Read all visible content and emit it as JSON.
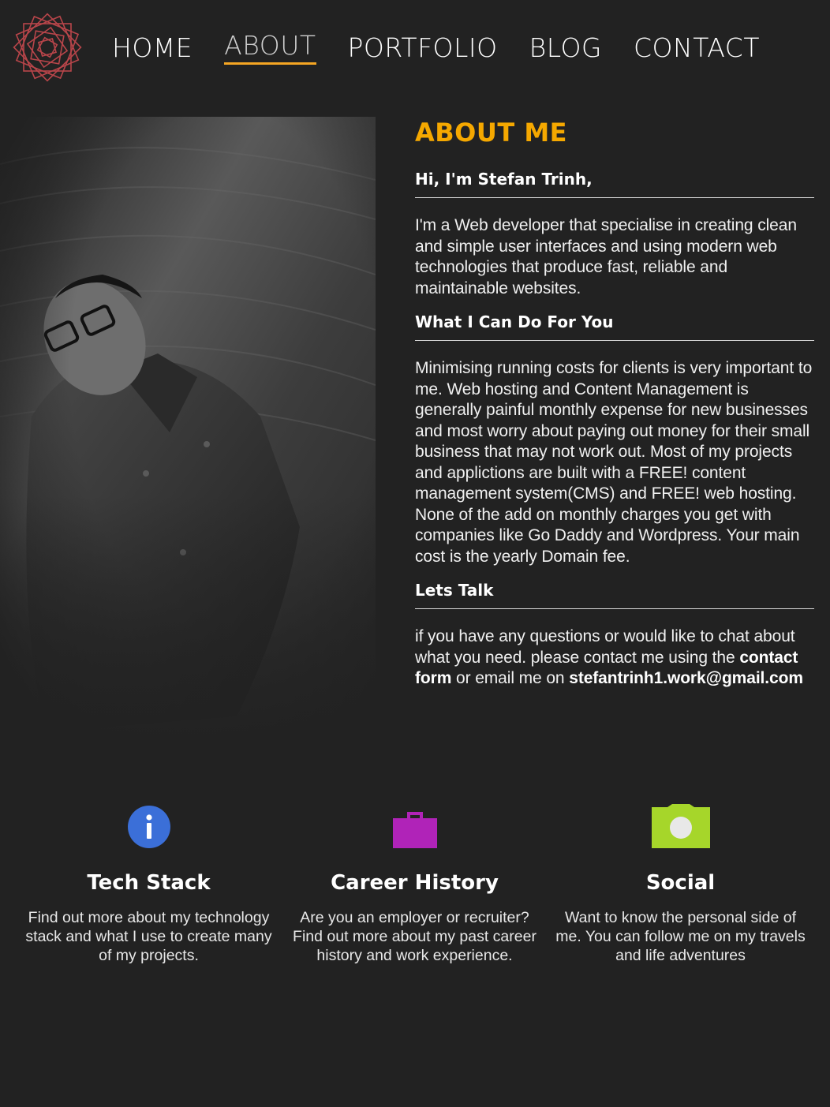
{
  "nav": {
    "logo": "logo-mark",
    "items": [
      {
        "label": "HOME",
        "active": false
      },
      {
        "label": "ABOUT",
        "active": true
      },
      {
        "label": "PORTFOLIO",
        "active": false
      },
      {
        "label": "BLOG",
        "active": false
      },
      {
        "label": "CONTACT",
        "active": false
      }
    ],
    "active_color": "#f5a623"
  },
  "about": {
    "title": "ABOUT ME",
    "greeting": "Hi, I'm Stefan Trinh,",
    "intro": "I'm a Web developer that specialise in creating clean and simple user interfaces and using modern web technologies that produce fast, reliable and maintainable websites.",
    "what_title": "What I Can Do For You",
    "what_text": "Minimising running costs for clients is very important to me. Web hosting and Content Management is generally painful monthly expense for new businesses and most worry about paying out money for their small business that may not work out. Most of my projects and applictions are built with a FREE! content management system(CMS) and FREE! web hosting. None of the add on monthly charges you get with companies like Go Daddy and Wordpress. Your main cost is the yearly Domain fee.",
    "talk_title": "Lets Talk",
    "talk_text_1": "if you have any questions or would like to chat about what you need. please contact me using the ",
    "talk_link": "contact form",
    "talk_text_2": " or email me on ",
    "talk_email": "stefantrinh1.work@gmail.com",
    "title_color": "#f5a800"
  },
  "features": [
    {
      "icon": "info-icon",
      "color": "#3b6fd8",
      "title": "Tech Stack",
      "text": "Find out more about my technology stack and what I use to create many of my projects."
    },
    {
      "icon": "briefcase-icon",
      "color": "#b023b8",
      "title": "Career History",
      "text": "Are you an employer or recruiter? Find out more about my past career history and work experience."
    },
    {
      "icon": "camera-icon",
      "color": "#a6d62a",
      "title": "Social",
      "text": "Want to know the personal side of me. You can follow me on my travels and life adventures"
    }
  ]
}
